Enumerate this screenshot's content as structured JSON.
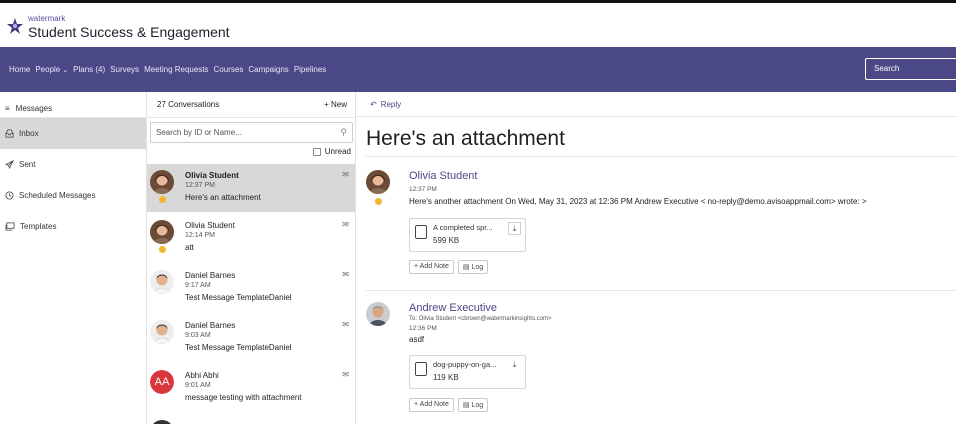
{
  "header": {
    "brand_small": "watermark",
    "app_title": "Student Success & Engagement"
  },
  "nav": {
    "items": [
      {
        "label": "Home",
        "dropdown": false
      },
      {
        "label": "People",
        "dropdown": true
      },
      {
        "label": "Plans (4)",
        "dropdown": false
      },
      {
        "label": "Surveys",
        "dropdown": false
      },
      {
        "label": "Meeting Requests",
        "dropdown": false
      },
      {
        "label": "Courses",
        "dropdown": false
      },
      {
        "label": "Campaigns",
        "dropdown": false
      },
      {
        "label": "Pipelines",
        "dropdown": false
      }
    ],
    "search_label": "Search"
  },
  "sidebar": {
    "header": "Messages",
    "items": [
      {
        "label": "Inbox",
        "icon": "inbox-icon",
        "active": true
      },
      {
        "label": "Sent",
        "icon": "send-icon",
        "active": false
      },
      {
        "label": "Scheduled Messages",
        "icon": "clock-icon",
        "active": false
      },
      {
        "label": "Templates",
        "icon": "template-icon",
        "active": false
      }
    ]
  },
  "conversations": {
    "count_label": "27 Conversations",
    "new_label": "+ New",
    "search_placeholder": "Search by ID or Name...",
    "unread_label": "Unread",
    "items": [
      {
        "name": "Olivia Student",
        "time": "12:37 PM",
        "preview": "Here's an attachment",
        "selected": true,
        "unread": true,
        "dot": true,
        "avatar": "olivia"
      },
      {
        "name": "Olivia Student",
        "time": "12:14 PM",
        "preview": "att",
        "selected": false,
        "unread": false,
        "dot": true,
        "avatar": "olivia"
      },
      {
        "name": "Daniel Barnes",
        "time": "9:17 AM",
        "preview": "Test Message TemplateDaniel",
        "selected": false,
        "unread": false,
        "dot": false,
        "avatar": "daniel"
      },
      {
        "name": "Daniel Barnes",
        "time": "9:03 AM",
        "preview": "Test Message TemplateDaniel",
        "selected": false,
        "unread": false,
        "dot": false,
        "avatar": "daniel"
      },
      {
        "name": "Abhi Abhi",
        "time": "9:01 AM",
        "preview": "message testing with attachment",
        "selected": false,
        "unread": false,
        "dot": false,
        "avatar": "initials",
        "initials": "AA"
      }
    ]
  },
  "thread": {
    "reply_label": "Reply",
    "subject": "Here's an attachment",
    "messages": [
      {
        "sender": "Olivia Student",
        "to": "",
        "time": "12:37 PM",
        "body": "Here's another attachment On Wed, May 31, 2023 at 12:36 PM Andrew Executive < no-reply@demo.avisoappmail.com> wrote: >",
        "attachment": {
          "name": "A completed spr...",
          "size": "599 KB"
        },
        "add_note": "+ Add Note",
        "log": "Log"
      },
      {
        "sender": "Andrew Executive",
        "to": "To: Olivia Student <cbrown@watermarkinsights.com>",
        "time": "12:36 PM",
        "body": "asdf",
        "attachment": {
          "name": "dog-puppy-on-ga...",
          "size": "119 KB"
        },
        "add_note": "+ Add Note",
        "log": "Log"
      }
    ]
  },
  "colors": {
    "nav_bg": "#4b4887",
    "selected_bg": "#d8d8d8",
    "accent": "#4b4887",
    "status_dot": "#f2b632",
    "initials_bg": "#d9363e"
  }
}
